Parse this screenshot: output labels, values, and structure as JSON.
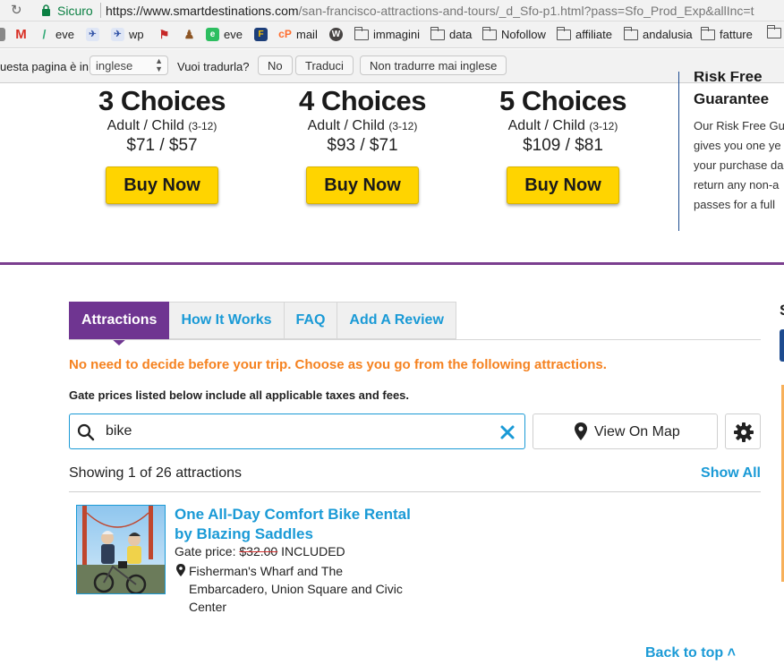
{
  "browser": {
    "secure_label": "Sicuro",
    "url_main": "https://www.smartdestinations.com",
    "url_rest": "/san-francisco-attractions-and-tours/_d_Sfo-p1.html?pass=Sfo_Prod_Exp&allInc=t"
  },
  "bookmarks": [
    {
      "label": "eve"
    },
    {
      "label": "wp"
    },
    {
      "label": "eve"
    },
    {
      "label": "mail"
    },
    {
      "label": "immagini"
    },
    {
      "label": "data"
    },
    {
      "label": "Nofollow"
    },
    {
      "label": "affiliate"
    },
    {
      "label": "andalusia"
    },
    {
      "label": "fatture"
    }
  ],
  "translate_bar": {
    "prompt": "uesta pagina è in",
    "language": "inglese",
    "question": "Vuoi tradurla?",
    "no_label": "No",
    "translate_label": "Traduci",
    "never_label": "Non tradurre mai inglese"
  },
  "plans": [
    {
      "title": "3 Choices",
      "sub": "Adult / Child",
      "age": "(3-12)",
      "price": "$71 / $57",
      "button": "Buy Now"
    },
    {
      "title": "4 Choices",
      "sub": "Adult / Child",
      "age": "(3-12)",
      "price": "$93 / $71",
      "button": "Buy Now"
    },
    {
      "title": "5 Choices",
      "sub": "Adult / Child",
      "age": "(3-12)",
      "price": "$109 / $81",
      "button": "Buy Now"
    }
  ],
  "risk": {
    "title_top": "Risk Free",
    "title": "Guarantee",
    "lines": [
      "Our Risk Free Gu",
      "gives you one ye",
      "your purchase da",
      "return any non-a",
      "passes for a full"
    ]
  },
  "tabs": [
    {
      "label": "Attractions"
    },
    {
      "label": "How It Works"
    },
    {
      "label": "FAQ"
    },
    {
      "label": "Add A Review"
    }
  ],
  "intro": "No need to decide before your trip. Choose as you go from the following attractions.",
  "gate_note": "Gate prices listed below include all applicable taxes and fees.",
  "search": {
    "value": "bike"
  },
  "map_button": "View On Map",
  "results": {
    "showing": "Showing 1 of 26 attractions",
    "show_all": "Show All"
  },
  "attraction": {
    "title": "One All-Day Comfort Bike Rental by Blazing Saddles",
    "gate_label": "Gate price:",
    "price": "$32.00",
    "included": "INCLUDED",
    "location": "Fisherman's Wharf and The Embarcadero, Union Square and Civic Center"
  },
  "back_to_top": "Back to top",
  "edge_letter": "S",
  "colors": {
    "purple": "#6f3591",
    "blue": "#1a9ad6",
    "orange": "#f58220",
    "yellow": "#ffd400"
  }
}
